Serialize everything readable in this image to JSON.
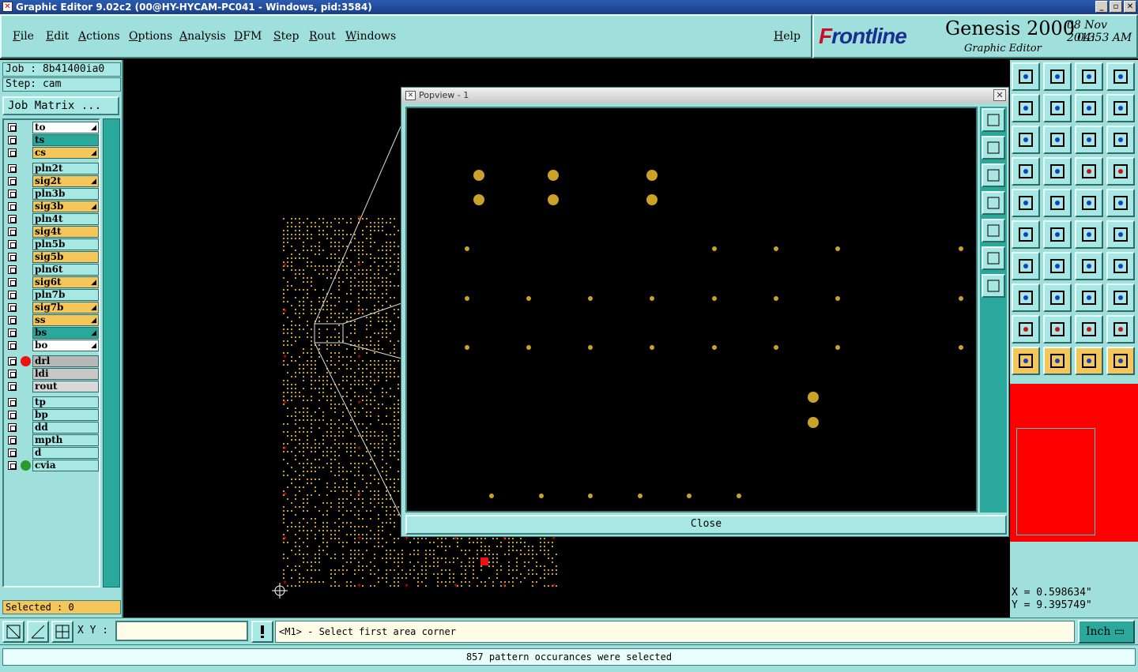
{
  "window": {
    "title": "Graphic Editor 9.02c2 (00@HY-HYCAM-PC041 - Windows, pid:3584)",
    "buttons": [
      "_",
      "▫",
      "✕"
    ]
  },
  "menu": [
    "File",
    "Edit",
    "Actions",
    "Options",
    "Analysis",
    "DFM",
    "Step",
    "Rout",
    "Windows"
  ],
  "help": "Help",
  "brand": {
    "logo_prefix": "F",
    "logo_rest": "rontline",
    "product": "Genesis 2000",
    "subtitle": "Graphic Editor",
    "date": "08 Nov 2013",
    "time": "04:53 AM"
  },
  "job": {
    "job_label": "Job : 8b41400ia0",
    "step_label": "Step: cam",
    "matrix_button": "Job Matrix ..."
  },
  "layers": [
    {
      "name": "to",
      "color": "#ffffff",
      "arrow": true
    },
    {
      "name": "ts",
      "color": "#2aa89c",
      "arrow": false
    },
    {
      "name": "cs",
      "color": "#f5c65a",
      "arrow": true
    },
    {
      "name": "pln2t",
      "color": "#a8e8e4",
      "arrow": false
    },
    {
      "name": "sig2t",
      "color": "#f5c65a",
      "arrow": true
    },
    {
      "name": "pln3b",
      "color": "#a8e8e4",
      "arrow": false
    },
    {
      "name": "sig3b",
      "color": "#f5c65a",
      "arrow": true
    },
    {
      "name": "pln4t",
      "color": "#a8e8e4",
      "arrow": false
    },
    {
      "name": "sig4t",
      "color": "#f5c65a",
      "arrow": false
    },
    {
      "name": "pln5b",
      "color": "#a8e8e4",
      "arrow": false
    },
    {
      "name": "sig5b",
      "color": "#f5c65a",
      "arrow": false
    },
    {
      "name": "pln6t",
      "color": "#a8e8e4",
      "arrow": false
    },
    {
      "name": "sig6t",
      "color": "#f5c65a",
      "arrow": true
    },
    {
      "name": "pln7b",
      "color": "#a8e8e4",
      "arrow": false
    },
    {
      "name": "sig7b",
      "color": "#f5c65a",
      "arrow": true
    },
    {
      "name": "ss",
      "color": "#f5c65a",
      "arrow": true
    },
    {
      "name": "bs",
      "color": "#2aa89c",
      "arrow": true
    },
    {
      "name": "bo",
      "color": "#ffffff",
      "arrow": true
    },
    {
      "name": "drl",
      "color": "#b8b8b8",
      "dot": "#ee1111",
      "arrow": false
    },
    {
      "name": "ldi",
      "color": "#c8c8c8",
      "arrow": false
    },
    {
      "name": "rout",
      "color": "#d8d8d8",
      "arrow": false
    },
    {
      "name": "tp",
      "color": "#a8e8e4",
      "arrow": false
    },
    {
      "name": "bp",
      "color": "#a8e8e4",
      "arrow": false
    },
    {
      "name": "dd",
      "color": "#a8e8e4",
      "arrow": false
    },
    {
      "name": "mpth",
      "color": "#a8e8e4",
      "arrow": false
    },
    {
      "name": "d",
      "color": "#a8e8e4",
      "arrow": false
    },
    {
      "name": "cvia",
      "color": "#a8e8e4",
      "dot": "#2a9a2a",
      "arrow": false
    }
  ],
  "selected": "Selected : 0",
  "popview": {
    "title": "Popview - 1",
    "close_label": "Close"
  },
  "coords": {
    "x": "X = 0.598634\"",
    "y": "Y = 9.395749\""
  },
  "bottom": {
    "xy_label": "X Y :",
    "xy_value": "",
    "prompt": "<M1> - Select first area corner",
    "units": "Inch",
    "status": "857 pattern occurances were selected"
  },
  "colors": {
    "accent": "#9fe0dc",
    "pad": "#c9a227",
    "drill": "#ee1111",
    "map": "#ff0000"
  }
}
